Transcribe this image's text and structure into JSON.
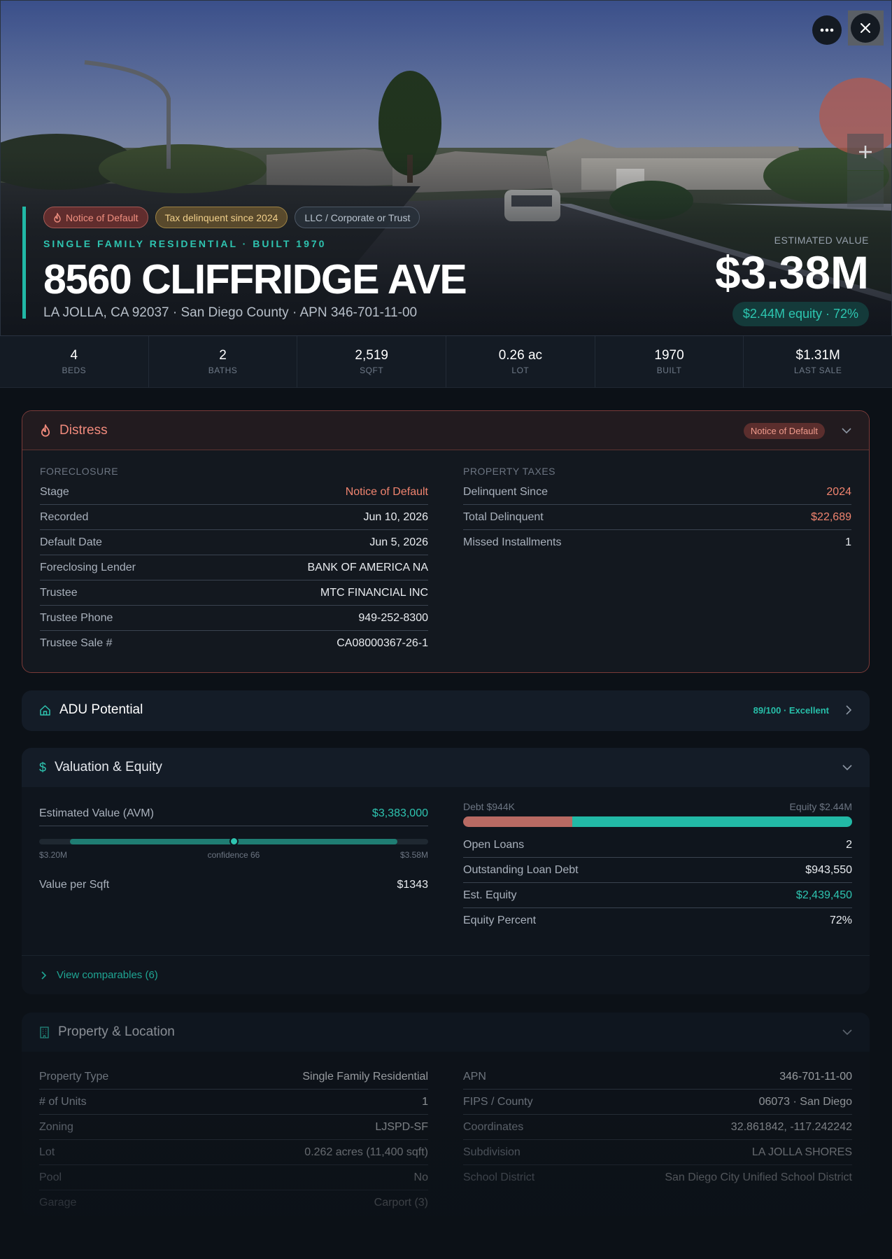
{
  "header": {
    "tags": [
      "Notice of Default",
      "Tax delinquent since 2024",
      "LLC / Corporate or Trust"
    ],
    "subtitle": "SINGLE FAMILY RESIDENTIAL · BUILT 1970",
    "address": "8560 CLIFFRIDGE AVE",
    "location": "LA JOLLA, CA 92037 · San Diego County · APN 346-701-11-00",
    "estimated_value_label": "ESTIMATED VALUE",
    "estimated_value": "$3.38M",
    "equity_pill": "$2.44M equity · 72%",
    "more_icon": "ellipsis-icon",
    "close_icon": "close-icon",
    "zoom_in_icon": "plus-icon"
  },
  "stats": [
    {
      "value": "4",
      "label": "BEDS"
    },
    {
      "value": "2",
      "label": "BATHS"
    },
    {
      "value": "2,519",
      "label": "SQFT"
    },
    {
      "value": "0.26 ac",
      "label": "LOT"
    },
    {
      "value": "1970",
      "label": "BUILT"
    },
    {
      "value": "$1.31M",
      "label": "LAST SALE"
    }
  ],
  "distress": {
    "title": "Distress",
    "badge": "Notice of Default",
    "foreclosure_label": "FORECLOSURE",
    "foreclosure": [
      {
        "k": "Stage",
        "v": "Notice of Default"
      },
      {
        "k": "Recorded",
        "v": "Jun 10, 2026"
      },
      {
        "k": "Default Date",
        "v": "Jun 5, 2026"
      },
      {
        "k": "Foreclosing Lender",
        "v": "BANK OF AMERICA NA"
      },
      {
        "k": "Trustee",
        "v": "MTC FINANCIAL INC"
      },
      {
        "k": "Trustee Phone",
        "v": "949-252-8300"
      },
      {
        "k": "Trustee Sale #",
        "v": "CA08000367-26-1"
      }
    ],
    "taxes_label": "PROPERTY TAXES",
    "taxes": [
      {
        "k": "Delinquent Since",
        "v": "2024"
      },
      {
        "k": "Total Delinquent",
        "v": "$22,689"
      },
      {
        "k": "Missed Installments",
        "v": "1"
      }
    ]
  },
  "adu": {
    "title": "ADU Potential",
    "score": "89/100 · Excellent"
  },
  "valuation": {
    "title": "Valuation & Equity",
    "avm_label": "Estimated Value (AVM)",
    "avm_value": "$3,383,000",
    "range_low": "$3.20M",
    "range_high": "$3.58M",
    "confidence": "confidence 66",
    "value_per_sqft_label": "Value per Sqft",
    "value_per_sqft": "$1343",
    "debt_label": "Debt $944K",
    "equity_label": "Equity $2.44M",
    "equity_fraction": 0.72,
    "rows": [
      {
        "k": "Open Loans",
        "v": "2"
      },
      {
        "k": "Outstanding Loan Debt",
        "v": "$943,550"
      },
      {
        "k": "Est. Equity",
        "v": "$2,439,450"
      },
      {
        "k": "Equity Percent",
        "v": "72%"
      }
    ],
    "view_comps": "View comparables (6)"
  },
  "property": {
    "title": "Property & Location",
    "left": [
      {
        "k": "Property Type",
        "v": "Single Family Residential"
      },
      {
        "k": "# of Units",
        "v": "1"
      },
      {
        "k": "Zoning",
        "v": "LJSPD-SF"
      },
      {
        "k": "Lot",
        "v": "0.262 acres (11,400 sqft)"
      },
      {
        "k": "Pool",
        "v": "No"
      },
      {
        "k": "Garage",
        "v": "Carport (3)"
      }
    ],
    "right": [
      {
        "k": "APN",
        "v": "346-701-11-00"
      },
      {
        "k": "FIPS / County",
        "v": "06073 · San Diego"
      },
      {
        "k": "Coordinates",
        "v": "32.861842, -117.242242"
      },
      {
        "k": "Subdivision",
        "v": "LA JOLLA SHORES"
      },
      {
        "k": "School District",
        "v": "San Diego City Unified School District"
      }
    ]
  },
  "colors": {
    "accent": "#2ec4b0",
    "danger": "#f0846f",
    "background": "#0c1117"
  }
}
